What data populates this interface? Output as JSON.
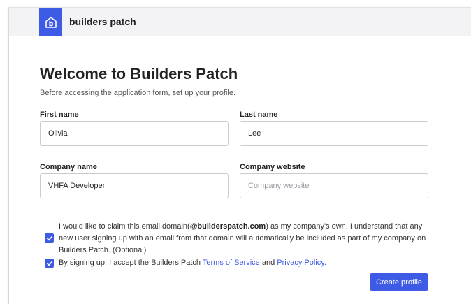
{
  "header": {
    "brand": "builders patch",
    "logo_icon": "house-b-icon",
    "accent": "#3d5be4"
  },
  "form": {
    "title": "Welcome to Builders Patch",
    "subtitle": "Before accessing the application form, set up your profile.",
    "first_name": {
      "label": "First name",
      "value": "Olivia",
      "placeholder": ""
    },
    "last_name": {
      "label": "Last name",
      "value": "Lee",
      "placeholder": ""
    },
    "company_name": {
      "label": "Company name",
      "value": "VHFA Developer",
      "placeholder": ""
    },
    "company_website": {
      "label": "Company website",
      "value": "",
      "placeholder": "Company website"
    },
    "claim_domain": {
      "checked": true,
      "text_before": "I would like to claim this email domain(",
      "domain": "@builderspatch.com",
      "text_after": ") as my company's own. I understand that any new user signing up with an email from that domain will automatically be included as part of my company on Builders Patch. (Optional)"
    },
    "terms": {
      "checked": true,
      "text_before": "By signing up, I accept the Builders Patch ",
      "terms_link": "Terms of Service",
      "and": " and ",
      "privacy_link": "Privacy Policy."
    },
    "submit_label": "Create profile"
  }
}
